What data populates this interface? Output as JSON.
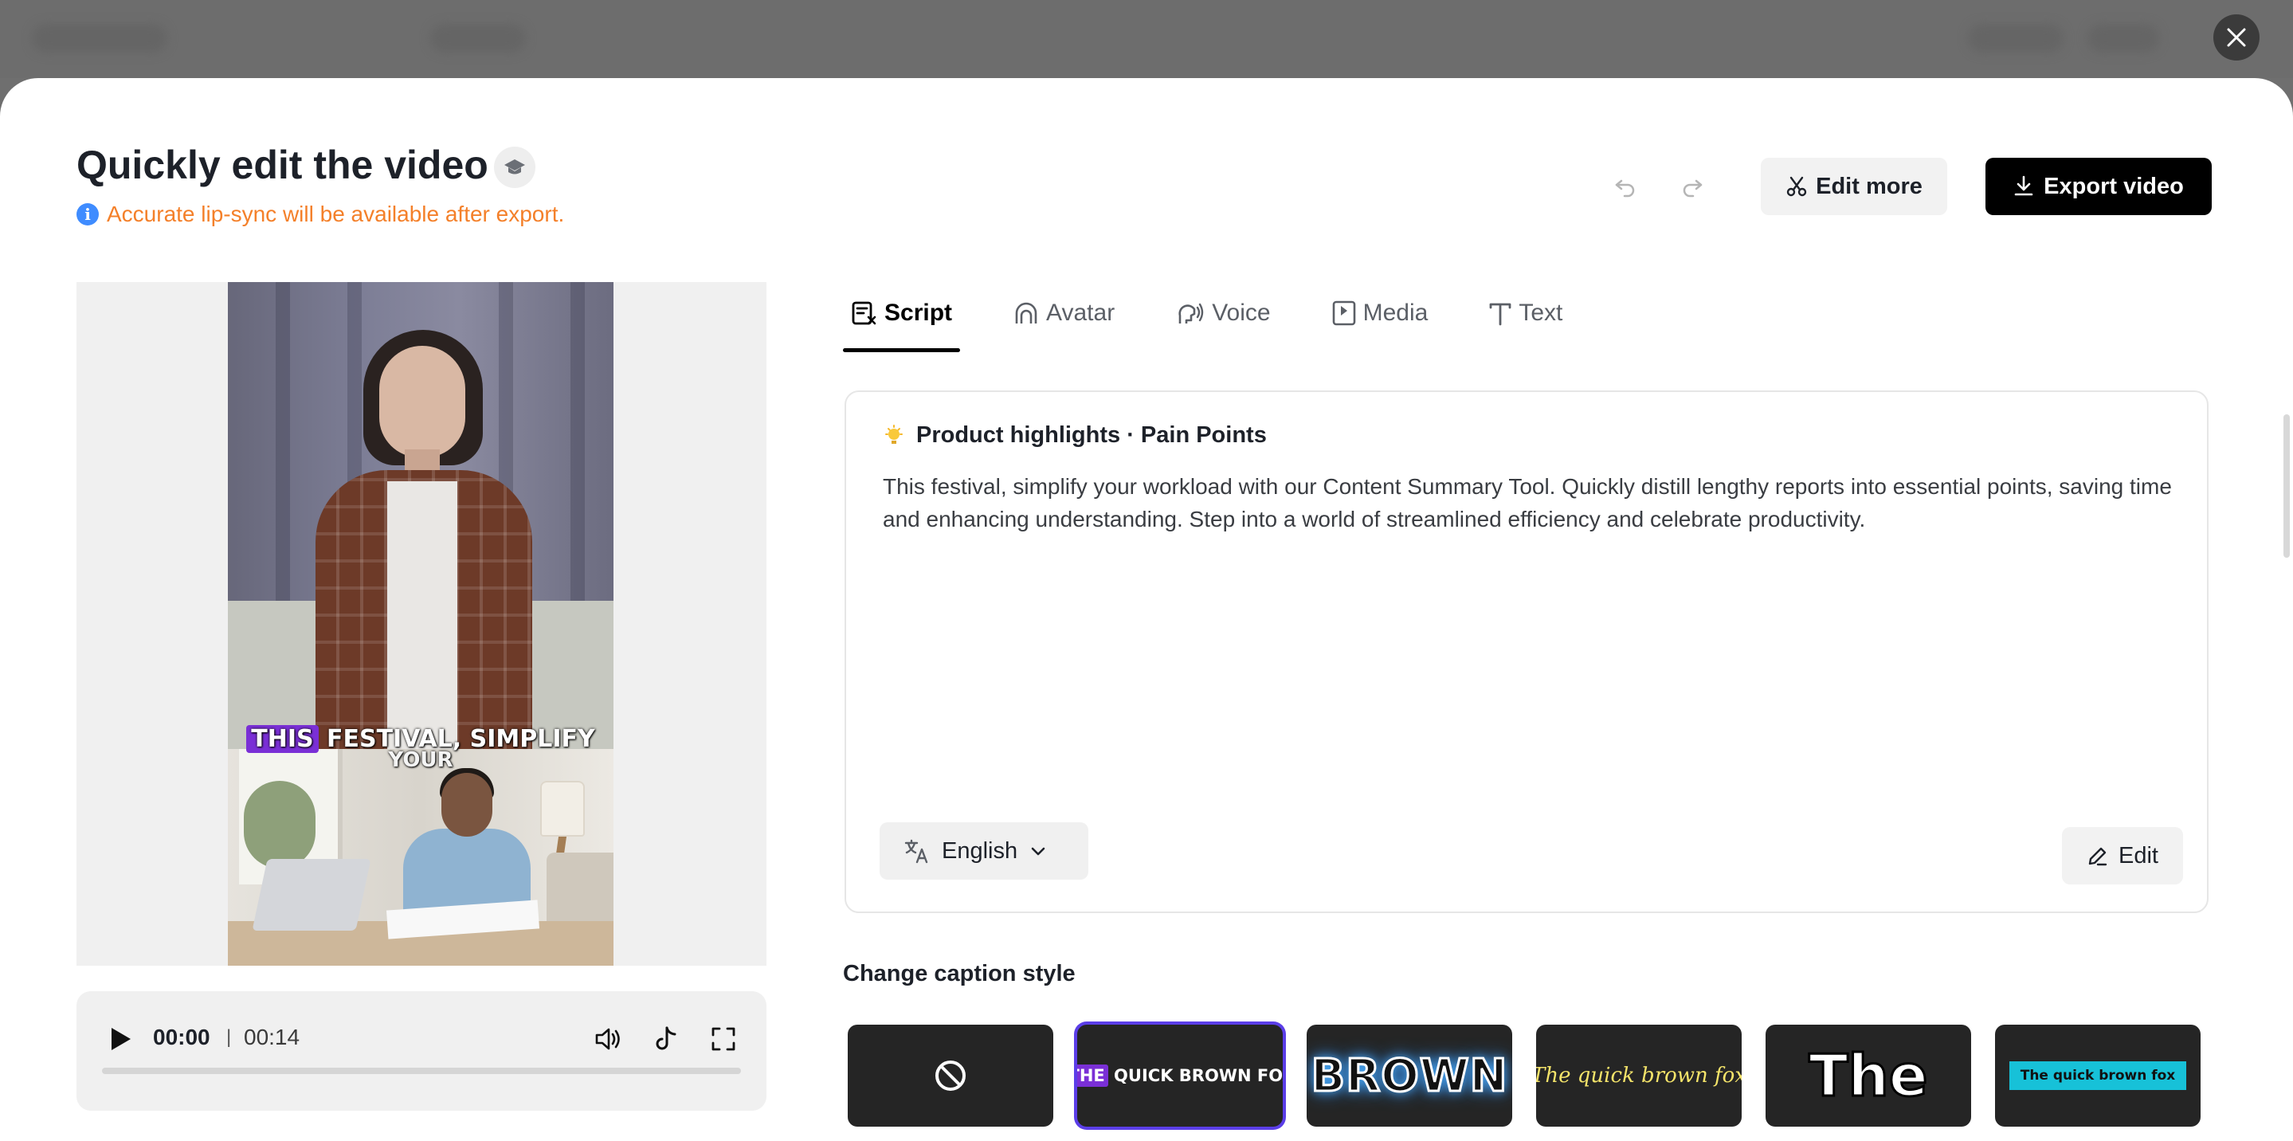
{
  "page": {
    "title": "Quickly edit the video",
    "notice": "Accurate lip-sync will be available after export.",
    "notice_icon": "info-icon",
    "title_icon": "graduation-cap-icon"
  },
  "toolbar": {
    "undo_icon": "undo-icon",
    "redo_icon": "redo-icon",
    "edit_more_label": "Edit more",
    "export_label": "Export video"
  },
  "preview": {
    "caption_highlight": "THIS",
    "caption_line1_rest": " FESTIVAL, SIMPLIFY",
    "caption_line2": "YOUR"
  },
  "player": {
    "current_time": "00:00",
    "separator": "|",
    "total_time": "00:14",
    "progress": 0
  },
  "tabs": [
    {
      "label": "Script",
      "icon": "script-icon",
      "active": true
    },
    {
      "label": "Avatar",
      "icon": "avatar-icon",
      "active": false
    },
    {
      "label": "Voice",
      "icon": "voice-icon",
      "active": false
    },
    {
      "label": "Media",
      "icon": "media-icon",
      "active": false
    },
    {
      "label": "Text",
      "icon": "text-icon",
      "active": false
    }
  ],
  "script": {
    "title": "Product highlights · Pain Points",
    "body": "This festival, simplify your workload with our Content Summary Tool. Quickly distill lengthy reports into essential points, saving time and enhancing understanding. Step into a world of streamlined efficiency and celebrate productivity.",
    "language": "English",
    "edit_label": "Edit"
  },
  "captions": {
    "heading": "Change caption style",
    "styles": [
      {
        "id": "none",
        "label": "",
        "icon": "no-caption-icon"
      },
      {
        "id": "purple-highlight",
        "highlight": "THE",
        "label": " QUICK BROWN FOX",
        "selected": true
      },
      {
        "id": "glow",
        "label": "BROWN"
      },
      {
        "id": "italic-yellow",
        "label": "The quick brown fox"
      },
      {
        "id": "bold-outline",
        "label": "The"
      },
      {
        "id": "cyan-box",
        "label": "The quick brown fox"
      }
    ]
  },
  "colors": {
    "accent_purple": "#7a2fd6",
    "selection_border": "#5b3ee8",
    "notice_orange": "#f4802a",
    "info_blue": "#3f8cff",
    "export_bg": "#000000"
  }
}
